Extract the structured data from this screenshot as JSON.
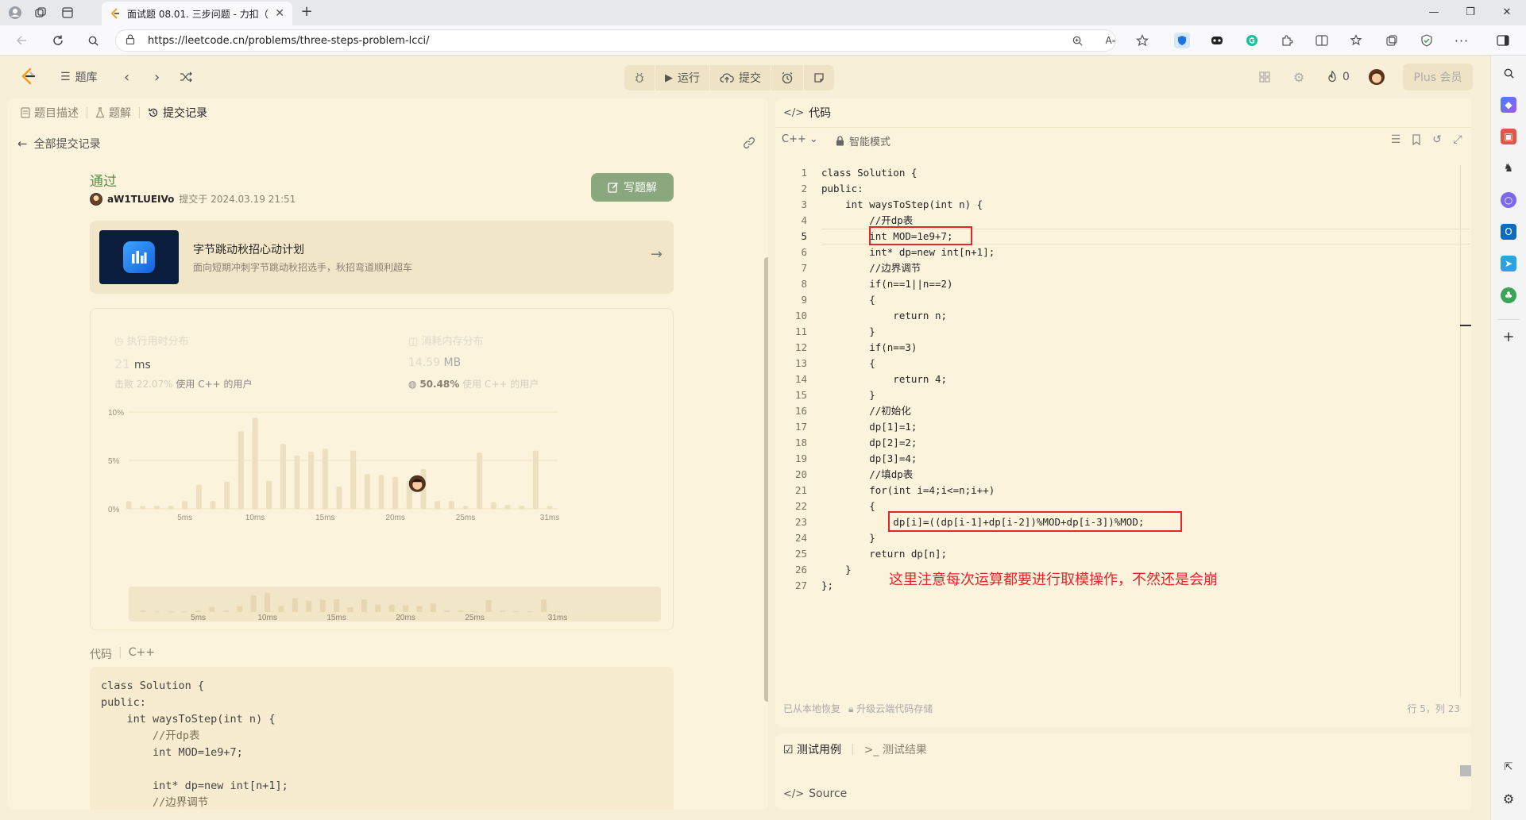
{
  "browser": {
    "tab_title": "面试题 08.01. 三步问题 - 力扣（L",
    "url": "https://leetcode.cn/problems/three-steps-problem-lcci/",
    "new_tab_label": "+",
    "tab_close": "✕",
    "window_controls": [
      "—",
      "❐",
      "✕"
    ]
  },
  "header": {
    "problem_bank_label": "题库",
    "run_label": "运行",
    "submit_label": "提交",
    "streak_count": "0",
    "plus_label": "Plus 会员"
  },
  "left": {
    "tabs": [
      "题目描述",
      "题解",
      "提交记录"
    ],
    "active_tab_index": 2,
    "back_label": "全部提交记录",
    "status": "通过",
    "username": "aW1TLUEIVo",
    "submitted_text": "提交于 2024.03.19 21:51",
    "write_solution_label": "写题解",
    "promo": {
      "title": "字节跳动秋招心动计划",
      "subtitle": "面向短期冲刺字节跳动秋招选手，秋招弯道顺利超车"
    },
    "runtime": {
      "title": "执行用时分布",
      "value": "21",
      "unit": "ms",
      "beat_prefix": "击败 22.07%",
      "beat_suffix": "使用 C++ 的用户"
    },
    "memory": {
      "title": "消耗内存分布",
      "value": "14.59",
      "unit": "MB",
      "beat_pct": "50.48%",
      "beat_suffix": "使用 C++ 的用户"
    },
    "code_label": "代码",
    "code_lang": "C++",
    "code_preview_lines": [
      "class Solution {",
      "public:",
      "    int waysToStep(int n) {",
      "        //开dp表",
      "        int MOD=1e9+7;",
      "",
      "        int* dp=new int[n+1];",
      "        //边界调节"
    ]
  },
  "chart_data": {
    "type": "bar",
    "ylim": [
      0,
      10
    ],
    "yticks": [
      "0%",
      "5%",
      "10%"
    ],
    "xticks": [
      "5ms",
      "10ms",
      "15ms",
      "20ms",
      "25ms",
      "31ms"
    ],
    "x": [
      1,
      2,
      3,
      4,
      5,
      6,
      7,
      8,
      9,
      10,
      11,
      12,
      13,
      14,
      15,
      16,
      17,
      18,
      19,
      20,
      21,
      22,
      23,
      24,
      25,
      26,
      27,
      28,
      29,
      30,
      31
    ],
    "values": [
      0.8,
      0.3,
      0.3,
      0.3,
      0.8,
      2.5,
      0.8,
      2.8,
      8.0,
      9.4,
      2.9,
      6.7,
      5.5,
      5.9,
      6.2,
      2.3,
      6.0,
      3.6,
      3.5,
      3.3,
      2.9,
      4.1,
      0.8,
      0.8,
      0.3,
      5.8,
      0.7,
      0.4,
      0.3,
      6.0,
      0.3
    ],
    "user_runtime_ms": 21,
    "minimap_xticks": [
      "5ms",
      "10ms",
      "15ms",
      "20ms",
      "25ms",
      "31ms"
    ]
  },
  "right": {
    "code_tab_label": "代码",
    "lang": "C++",
    "smart_mode_label": "智能模式",
    "code_lines": [
      "class Solution {",
      "public:",
      "    int waysToStep(int n) {",
      "        //开dp表",
      "        int MOD=1e9+7;",
      "        int* dp=new int[n+1];",
      "        //边界调节",
      "        if(n==1||n==2)",
      "        {",
      "            return n;",
      "        }",
      "        if(n==3)",
      "        {",
      "            return 4;",
      "        }",
      "        //初始化",
      "        dp[1]=1;",
      "        dp[2]=2;",
      "        dp[3]=4;",
      "        //填dp表",
      "        for(int i=4;i<=n;i++)",
      "        {",
      "            dp[i]=((dp[i-1]+dp[i-2])%MOD+dp[i-3])%MOD;",
      "        }",
      "        return dp[n];",
      "    }",
      "};"
    ],
    "current_line": 5,
    "annotation": "这里注意每次运算都要进行取模操作，不然还是会崩",
    "restored_label": "已从本地恢复",
    "cloud_label": "升级云端代码存储",
    "cursor_pos": "行 5，列 23",
    "bottom_tabs": [
      "测试用例",
      "测试结果"
    ],
    "source_label": "Source"
  }
}
